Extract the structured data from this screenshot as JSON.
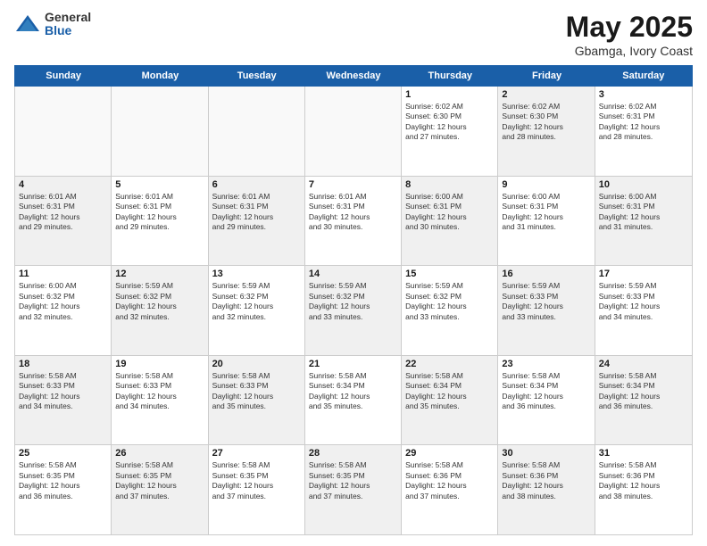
{
  "header": {
    "logo_general": "General",
    "logo_blue": "Blue",
    "title": "May 2025",
    "subtitle": "Gbamga, Ivory Coast"
  },
  "days": [
    "Sunday",
    "Monday",
    "Tuesday",
    "Wednesday",
    "Thursday",
    "Friday",
    "Saturday"
  ],
  "weeks": [
    [
      {
        "day": "",
        "text": "",
        "empty": true
      },
      {
        "day": "",
        "text": "",
        "empty": true
      },
      {
        "day": "",
        "text": "",
        "empty": true
      },
      {
        "day": "",
        "text": "",
        "empty": true
      },
      {
        "day": "1",
        "text": "Sunrise: 6:02 AM\nSunset: 6:30 PM\nDaylight: 12 hours\nand 27 minutes.",
        "shaded": false
      },
      {
        "day": "2",
        "text": "Sunrise: 6:02 AM\nSunset: 6:30 PM\nDaylight: 12 hours\nand 28 minutes.",
        "shaded": true
      },
      {
        "day": "3",
        "text": "Sunrise: 6:02 AM\nSunset: 6:31 PM\nDaylight: 12 hours\nand 28 minutes.",
        "shaded": false
      }
    ],
    [
      {
        "day": "4",
        "text": "Sunrise: 6:01 AM\nSunset: 6:31 PM\nDaylight: 12 hours\nand 29 minutes.",
        "shaded": true
      },
      {
        "day": "5",
        "text": "Sunrise: 6:01 AM\nSunset: 6:31 PM\nDaylight: 12 hours\nand 29 minutes.",
        "shaded": false
      },
      {
        "day": "6",
        "text": "Sunrise: 6:01 AM\nSunset: 6:31 PM\nDaylight: 12 hours\nand 29 minutes.",
        "shaded": true
      },
      {
        "day": "7",
        "text": "Sunrise: 6:01 AM\nSunset: 6:31 PM\nDaylight: 12 hours\nand 30 minutes.",
        "shaded": false
      },
      {
        "day": "8",
        "text": "Sunrise: 6:00 AM\nSunset: 6:31 PM\nDaylight: 12 hours\nand 30 minutes.",
        "shaded": true
      },
      {
        "day": "9",
        "text": "Sunrise: 6:00 AM\nSunset: 6:31 PM\nDaylight: 12 hours\nand 31 minutes.",
        "shaded": false
      },
      {
        "day": "10",
        "text": "Sunrise: 6:00 AM\nSunset: 6:31 PM\nDaylight: 12 hours\nand 31 minutes.",
        "shaded": true
      }
    ],
    [
      {
        "day": "11",
        "text": "Sunrise: 6:00 AM\nSunset: 6:32 PM\nDaylight: 12 hours\nand 32 minutes.",
        "shaded": false
      },
      {
        "day": "12",
        "text": "Sunrise: 5:59 AM\nSunset: 6:32 PM\nDaylight: 12 hours\nand 32 minutes.",
        "shaded": true
      },
      {
        "day": "13",
        "text": "Sunrise: 5:59 AM\nSunset: 6:32 PM\nDaylight: 12 hours\nand 32 minutes.",
        "shaded": false
      },
      {
        "day": "14",
        "text": "Sunrise: 5:59 AM\nSunset: 6:32 PM\nDaylight: 12 hours\nand 33 minutes.",
        "shaded": true
      },
      {
        "day": "15",
        "text": "Sunrise: 5:59 AM\nSunset: 6:32 PM\nDaylight: 12 hours\nand 33 minutes.",
        "shaded": false
      },
      {
        "day": "16",
        "text": "Sunrise: 5:59 AM\nSunset: 6:33 PM\nDaylight: 12 hours\nand 33 minutes.",
        "shaded": true
      },
      {
        "day": "17",
        "text": "Sunrise: 5:59 AM\nSunset: 6:33 PM\nDaylight: 12 hours\nand 34 minutes.",
        "shaded": false
      }
    ],
    [
      {
        "day": "18",
        "text": "Sunrise: 5:58 AM\nSunset: 6:33 PM\nDaylight: 12 hours\nand 34 minutes.",
        "shaded": true
      },
      {
        "day": "19",
        "text": "Sunrise: 5:58 AM\nSunset: 6:33 PM\nDaylight: 12 hours\nand 34 minutes.",
        "shaded": false
      },
      {
        "day": "20",
        "text": "Sunrise: 5:58 AM\nSunset: 6:33 PM\nDaylight: 12 hours\nand 35 minutes.",
        "shaded": true
      },
      {
        "day": "21",
        "text": "Sunrise: 5:58 AM\nSunset: 6:34 PM\nDaylight: 12 hours\nand 35 minutes.",
        "shaded": false
      },
      {
        "day": "22",
        "text": "Sunrise: 5:58 AM\nSunset: 6:34 PM\nDaylight: 12 hours\nand 35 minutes.",
        "shaded": true
      },
      {
        "day": "23",
        "text": "Sunrise: 5:58 AM\nSunset: 6:34 PM\nDaylight: 12 hours\nand 36 minutes.",
        "shaded": false
      },
      {
        "day": "24",
        "text": "Sunrise: 5:58 AM\nSunset: 6:34 PM\nDaylight: 12 hours\nand 36 minutes.",
        "shaded": true
      }
    ],
    [
      {
        "day": "25",
        "text": "Sunrise: 5:58 AM\nSunset: 6:35 PM\nDaylight: 12 hours\nand 36 minutes.",
        "shaded": false
      },
      {
        "day": "26",
        "text": "Sunrise: 5:58 AM\nSunset: 6:35 PM\nDaylight: 12 hours\nand 37 minutes.",
        "shaded": true
      },
      {
        "day": "27",
        "text": "Sunrise: 5:58 AM\nSunset: 6:35 PM\nDaylight: 12 hours\nand 37 minutes.",
        "shaded": false
      },
      {
        "day": "28",
        "text": "Sunrise: 5:58 AM\nSunset: 6:35 PM\nDaylight: 12 hours\nand 37 minutes.",
        "shaded": true
      },
      {
        "day": "29",
        "text": "Sunrise: 5:58 AM\nSunset: 6:36 PM\nDaylight: 12 hours\nand 37 minutes.",
        "shaded": false
      },
      {
        "day": "30",
        "text": "Sunrise: 5:58 AM\nSunset: 6:36 PM\nDaylight: 12 hours\nand 38 minutes.",
        "shaded": true
      },
      {
        "day": "31",
        "text": "Sunrise: 5:58 AM\nSunset: 6:36 PM\nDaylight: 12 hours\nand 38 minutes.",
        "shaded": false
      }
    ]
  ]
}
